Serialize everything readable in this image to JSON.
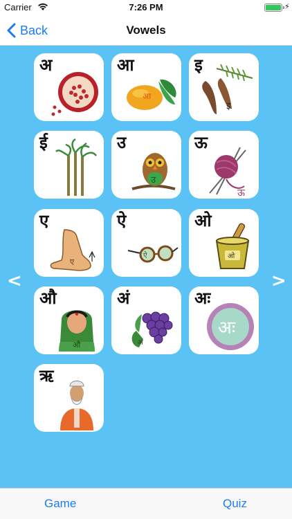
{
  "status_bar": {
    "carrier": "Carrier",
    "time": "7:26 PM",
    "battery_level": 1.0
  },
  "nav": {
    "back_label": "Back",
    "title": "Vowels"
  },
  "pager": {
    "prev": "<",
    "next": ">"
  },
  "vowels": [
    {
      "letter": "अ",
      "picture": "pomegranate",
      "inset": "अ"
    },
    {
      "letter": "आ",
      "picture": "mango",
      "inset": "आ"
    },
    {
      "letter": "इ",
      "picture": "tamarind",
      "inset": "इ"
    },
    {
      "letter": "ई",
      "picture": "sugarcane",
      "inset": ""
    },
    {
      "letter": "उ",
      "picture": "owl",
      "inset": "उ"
    },
    {
      "letter": "ऊ",
      "picture": "wool-yarn",
      "inset": "ऊ"
    },
    {
      "letter": "ए",
      "picture": "foot",
      "inset": "ए"
    },
    {
      "letter": "ऐ",
      "picture": "spectacles",
      "inset": "ऐ"
    },
    {
      "letter": "ओ",
      "picture": "mortar-pestle",
      "inset": "ओ"
    },
    {
      "letter": "औ",
      "picture": "woman",
      "inset": "औ"
    },
    {
      "letter": "अं",
      "picture": "grapes",
      "inset": "अं"
    },
    {
      "letter": "अः",
      "picture": "letter-circle",
      "inset": "अः"
    },
    {
      "letter": "ऋ",
      "picture": "sage",
      "inset": ""
    }
  ],
  "tabs": {
    "game": "Game",
    "quiz": "Quiz"
  },
  "colors": {
    "background": "#5bc2f5",
    "accent": "#1a7cf2",
    "card": "#ffffff"
  }
}
